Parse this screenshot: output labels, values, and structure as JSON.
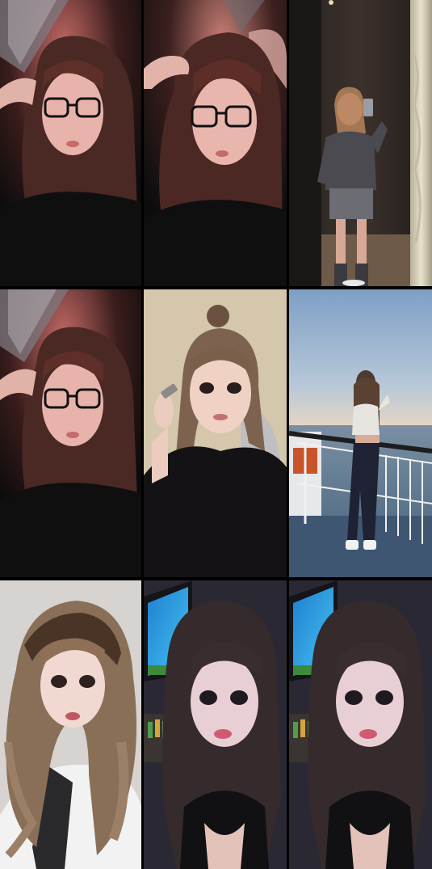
{
  "gallery": {
    "columns": 3,
    "rows": 3,
    "photos": [
      {
        "subject": "selfie-glasses-red-light"
      },
      {
        "subject": "selfie-glasses-hand-hair"
      },
      {
        "subject": "mirror-selfie-gray-sweater"
      },
      {
        "subject": "selfie-glasses-red-light"
      },
      {
        "subject": "selfie-hair-clip-bun"
      },
      {
        "subject": "ship-deck-ocean-sunset"
      },
      {
        "subject": "selfie-long-wavy-hair"
      },
      {
        "subject": "selfie-tv-background"
      },
      {
        "subject": "selfie-tv-background"
      }
    ]
  },
  "colors": {
    "background": "#000000",
    "red_glow": "#b84a4a",
    "skin": "#e8c4b6",
    "hair_brown": "#4a2a22",
    "sky_blue": "#8fb0d2",
    "sea": "#5c7690",
    "screen_blue": "#2fa5e8"
  }
}
